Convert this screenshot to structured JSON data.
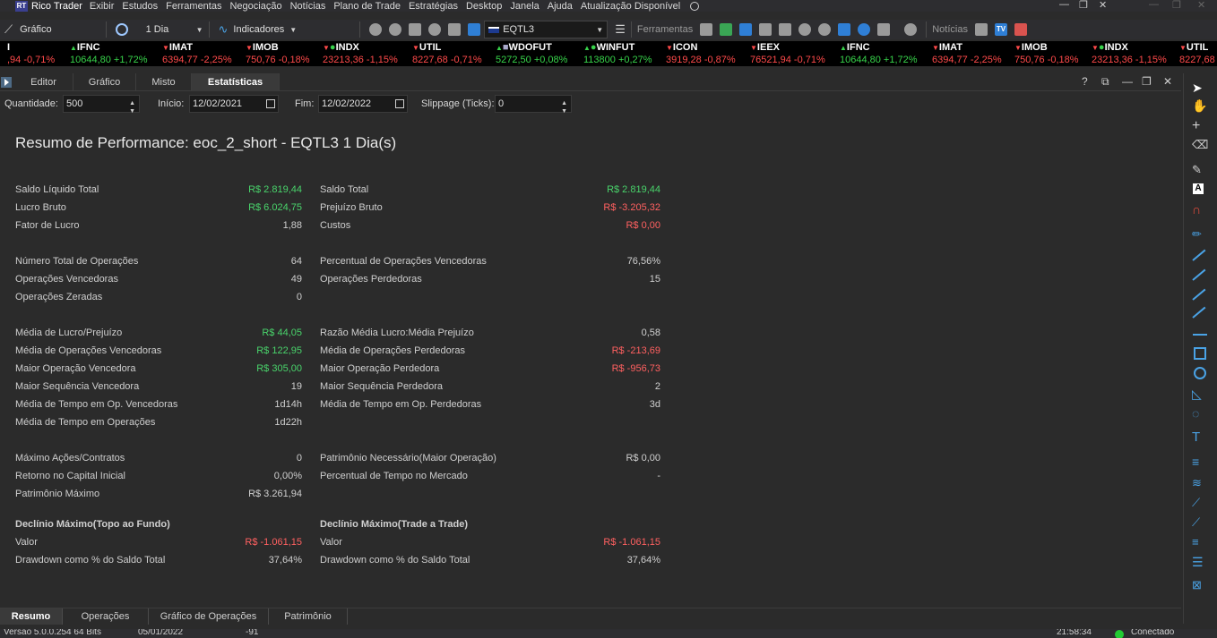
{
  "app": {
    "logo_text": "RT",
    "title": "Rico Trader"
  },
  "menu": [
    "Exibir",
    "Estudos",
    "Ferramentas",
    "Negociação",
    "Notícias",
    "Plano de Trade",
    "Estratégias",
    "Desktop",
    "Janela",
    "Ajuda",
    "Atualização Disponível"
  ],
  "toolbar": {
    "chart_label": "Gráfico",
    "period": "1 Dia",
    "indicators": "Indicadores",
    "symbol": "EQTL3",
    "tools_label": "Ferramentas",
    "news_label": "Notícias",
    "tv_label": "TV"
  },
  "ticker": [
    {
      "sym": "I",
      "val": ",94 -0,71%",
      "dir": "down"
    },
    {
      "sym": "IFNC",
      "val": "10644,80 +1,72%",
      "dir": "up"
    },
    {
      "sym": "IMAT",
      "val": "6394,77 -2,25%",
      "dir": "down"
    },
    {
      "sym": "IMOB",
      "val": "750,76 -0,18%",
      "dir": "down"
    },
    {
      "sym": "INDX",
      "val": "23213,36 -1,15%",
      "dir": "down"
    },
    {
      "sym": "UTIL",
      "val": "8227,68 -0,71%",
      "dir": "down"
    },
    {
      "sym": "WDOFUT",
      "val": "5272,50 +0,08%",
      "dir": "up"
    },
    {
      "sym": "WINFUT",
      "val": "113800 +0,27%",
      "dir": "up"
    },
    {
      "sym": "ICON",
      "val": "3919,28 -0,87%",
      "dir": "down"
    },
    {
      "sym": "IEEX",
      "val": "76521,94 -0,71%",
      "dir": "down"
    },
    {
      "sym": "IFNC",
      "val": "10644,80 +1,72%",
      "dir": "up"
    },
    {
      "sym": "IMAT",
      "val": "6394,77 -2,25%",
      "dir": "down"
    },
    {
      "sym": "IMOB",
      "val": "750,76 -0,18%",
      "dir": "down"
    },
    {
      "sym": "INDX",
      "val": "23213,36 -1,15%",
      "dir": "down"
    },
    {
      "sym": "UTIL",
      "val": "8227,68",
      "dir": "down"
    }
  ],
  "tabs": [
    "Editor",
    "Gráfico",
    "Misto",
    "Estatísticas"
  ],
  "params": {
    "quantity_label": "Quantidade:",
    "quantity": "500",
    "start_label": "Início:",
    "start": "12/02/2021",
    "end_label": "Fim:",
    "end": "12/02/2022",
    "slippage_label": "Slippage (Ticks):",
    "slippage": "0"
  },
  "report": {
    "title": "Resumo de Performance: eoc_2_short - EQTL3 1 Dia(s)",
    "left": [
      {
        "label": "Saldo Líquido Total",
        "value": "R$ 2.819,44",
        "color": "pos"
      },
      {
        "label": "Lucro Bruto",
        "value": "R$ 6.024,75",
        "color": "pos"
      },
      {
        "label": "Fator de Lucro",
        "value": "1,88",
        "color": ""
      },
      {
        "label": "Número Total de Operações",
        "value": "64",
        "color": ""
      },
      {
        "label": "Operações Vencedoras",
        "value": "49",
        "color": ""
      },
      {
        "label": "Operações Zeradas",
        "value": "0",
        "color": ""
      },
      {
        "label": "Média de Lucro/Prejuízo",
        "value": "R$ 44,05",
        "color": "pos"
      },
      {
        "label": "Média de Operações Vencedoras",
        "value": "R$ 122,95",
        "color": "pos"
      },
      {
        "label": "Maior Operação Vencedora",
        "value": "R$ 305,00",
        "color": "pos"
      },
      {
        "label": "Maior Sequência Vencedora",
        "value": "19",
        "color": ""
      },
      {
        "label": "Média de Tempo em Op. Vencedoras",
        "value": "1d14h",
        "color": ""
      },
      {
        "label": "Média de Tempo em Operações",
        "value": "1d22h",
        "color": ""
      },
      {
        "label": "Máximo Ações/Contratos",
        "value": "0",
        "color": ""
      },
      {
        "label": "Retorno no Capital Inicial",
        "value": "0,00%",
        "color": ""
      },
      {
        "label": "Patrimônio Máximo",
        "value": "R$ 3.261,94",
        "color": ""
      }
    ],
    "right": [
      {
        "label": "Saldo Total",
        "value": "R$ 2.819,44",
        "color": "pos"
      },
      {
        "label": "Prejuízo Bruto",
        "value": "R$ -3.205,32",
        "color": "neg"
      },
      {
        "label": "Custos",
        "value": "R$ 0,00",
        "color": "neg"
      },
      {
        "label": "Percentual de Operações Vencedoras",
        "value": "76,56%",
        "color": ""
      },
      {
        "label": "Operações Perdedoras",
        "value": "15",
        "color": ""
      },
      {
        "label": "",
        "value": "",
        "color": ""
      },
      {
        "label": "Razão Média Lucro:Média Prejuízo",
        "value": "0,58",
        "color": ""
      },
      {
        "label": "Média de Operações Perdedoras",
        "value": "R$ -213,69",
        "color": "neg"
      },
      {
        "label": "Maior Operação Perdedora",
        "value": "R$ -956,73",
        "color": "neg"
      },
      {
        "label": "Maior Sequência Perdedora",
        "value": "2",
        "color": ""
      },
      {
        "label": "Média de Tempo em Op. Perdedoras",
        "value": "3d",
        "color": ""
      },
      {
        "label": "",
        "value": "",
        "color": ""
      },
      {
        "label": "Patrimônio Necessário(Maior Operação)",
        "value": "R$ 0,00",
        "color": ""
      },
      {
        "label": "Percentual de Tempo no Mercado",
        "value": "-",
        "color": ""
      },
      {
        "label": "",
        "value": "",
        "color": ""
      }
    ],
    "drawdown_left": {
      "title": "Declínio Máximo(Topo ao Fundo)",
      "value_label": "Valor",
      "value": "R$ -1.061,15",
      "pct_label": "Drawdown como % do Saldo Total",
      "pct": "37,64%"
    },
    "drawdown_right": {
      "title": "Declínio Máximo(Trade a Trade)",
      "value_label": "Valor",
      "value": "R$ -1.061,15",
      "pct_label": "Drawdown como % do Saldo Total",
      "pct": "37,64%"
    }
  },
  "bottom_tabs": [
    "Resumo",
    "Operações",
    "Gráfico de Operações",
    "Patrimônio"
  ],
  "status": {
    "version": "Versão 5.0.0.254 64 Bits",
    "date": "05/01/2022",
    "code": "-91",
    "time": "21:58:34",
    "connection": "Conectado"
  },
  "colors": {
    "positive": "#49d46b",
    "negative": "#ff6060",
    "ticker_up": "#37d34a",
    "ticker_down": "#ff4a4a"
  }
}
